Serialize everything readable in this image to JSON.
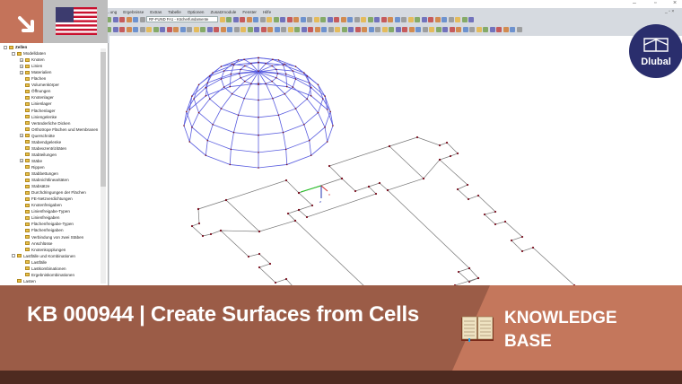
{
  "window": {
    "minimize": "–",
    "maximize": "▫",
    "close": "×"
  },
  "menu": [
    "…ung",
    "Ergebnisse",
    "Extras",
    "Tabelle",
    "Optionen",
    "Zusatzmodule",
    "Fenster",
    "Hilfe"
  ],
  "toolbar": {
    "project_select": "RF-FUND FA1 - Köcherfundamente"
  },
  "tree": [
    {
      "label": "Zellen",
      "level": 0,
      "expand": "-"
    },
    {
      "label": "Modelldaten",
      "level": 1,
      "expand": "-"
    },
    {
      "label": "Knoten",
      "level": 2,
      "expand": "+"
    },
    {
      "label": "Linien",
      "level": 2,
      "expand": "+"
    },
    {
      "label": "Materialien",
      "level": 2,
      "expand": "+"
    },
    {
      "label": "Flächen",
      "level": 2
    },
    {
      "label": "Volumenkörper",
      "level": 2
    },
    {
      "label": "Öffnungen",
      "level": 2
    },
    {
      "label": "Knotenlager",
      "level": 2
    },
    {
      "label": "Linienlager",
      "level": 2
    },
    {
      "label": "Flächenlager",
      "level": 2
    },
    {
      "label": "Liniengelenke",
      "level": 2
    },
    {
      "label": "Veränderliche Dicken",
      "level": 2
    },
    {
      "label": "Orthotrope Flächen und Membranen",
      "level": 2
    },
    {
      "label": "Querschnitte",
      "level": 2,
      "expand": "+"
    },
    {
      "label": "Stabendgelenke",
      "level": 2
    },
    {
      "label": "Stabexzentrizitäten",
      "level": 2
    },
    {
      "label": "Stabteilungen",
      "level": 2
    },
    {
      "label": "Stäbe",
      "level": 2,
      "expand": "+"
    },
    {
      "label": "Rippen",
      "level": 2
    },
    {
      "label": "Stabbettungen",
      "level": 2
    },
    {
      "label": "Stabnichtlinearitäten",
      "level": 2
    },
    {
      "label": "Stabsätze",
      "level": 2
    },
    {
      "label": "Durchdringungen der Flächen",
      "level": 2
    },
    {
      "label": "FE-Netzverdichtungen",
      "level": 2
    },
    {
      "label": "Knotenfreigaben",
      "level": 2
    },
    {
      "label": "Linienfreigabe-Typen",
      "level": 2
    },
    {
      "label": "Linienfreigaben",
      "level": 2
    },
    {
      "label": "Flächenfreigabe-Typen",
      "level": 2
    },
    {
      "label": "Flächenfreigaben",
      "level": 2
    },
    {
      "label": "Verbindung von zwei Stäben",
      "level": 2
    },
    {
      "label": "Anschlüsse",
      "level": 2
    },
    {
      "label": "Knotenkopplungen",
      "level": 2
    },
    {
      "label": "Lastfälle und Kombinationen",
      "level": 1,
      "expand": "-"
    },
    {
      "label": "Lastfälle",
      "level": 2
    },
    {
      "label": "Lastkombinationen",
      "level": 2
    },
    {
      "label": "Ergebniskombinationen",
      "level": 2
    },
    {
      "label": "Lasten",
      "level": 1
    }
  ],
  "axes": {
    "x": "x",
    "z": "z"
  },
  "logo": {
    "text": "Dlubal"
  },
  "banner": {
    "title": "KB 000944 | Create Surfaces from Cells",
    "category_line1": "KNOWLEDGE",
    "category_line2": "BASE"
  },
  "colors": {
    "accent": "#c4735a",
    "banner_dark": "#9b5c47",
    "banner_light": "#c4775c",
    "footer": "#4e2a20",
    "logo": "#2a2e6d",
    "dome": "#5a5ee0",
    "node": "#7a1020"
  }
}
